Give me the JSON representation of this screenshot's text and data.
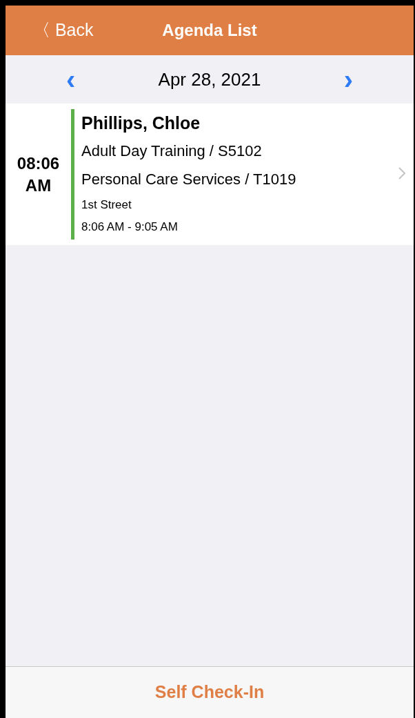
{
  "nav_bar": {
    "back": "〈 Back",
    "title": "Agenda List"
  },
  "date_bar": {
    "prev": "‹",
    "date": "Apr 28, 2021",
    "next": "›"
  },
  "appointments": [
    {
      "time": "08:06\nAM",
      "color": "#5cb04a",
      "client": "Phillips, Chloe",
      "services": [
        "Adult Day Training / S5102",
        "Personal Care Services / T1019"
      ],
      "location": "1st Street",
      "range": "8:06 AM - 9:05 AM"
    }
  ],
  "footer": {
    "button": "Self Check-In"
  }
}
